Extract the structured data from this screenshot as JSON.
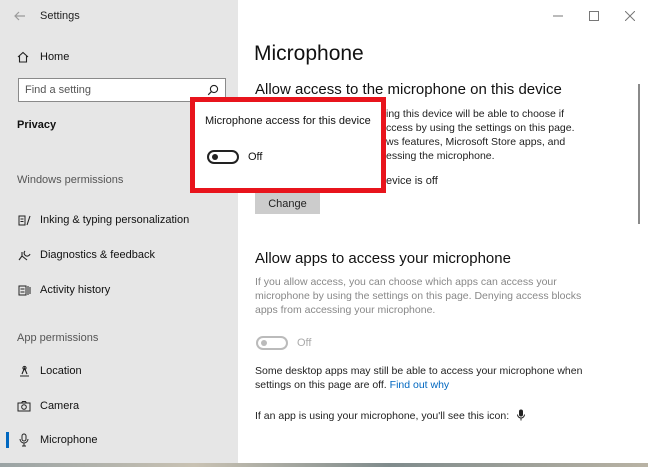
{
  "window": {
    "title": "Settings"
  },
  "sidebar": {
    "home_label": "Home",
    "search_placeholder": "Find a setting",
    "section_title": "Privacy",
    "windows_permissions": {
      "header": "Windows permissions",
      "items": [
        {
          "label": "Inking & typing personalization",
          "icon": "inking-icon"
        },
        {
          "label": "Diagnostics & feedback",
          "icon": "diagnostics-icon"
        },
        {
          "label": "Activity history",
          "icon": "activity-history-icon"
        }
      ]
    },
    "app_permissions": {
      "header": "App permissions",
      "items": [
        {
          "label": "Location",
          "icon": "location-icon"
        },
        {
          "label": "Camera",
          "icon": "camera-icon"
        },
        {
          "label": "Microphone",
          "icon": "microphone-icon"
        }
      ]
    }
  },
  "main": {
    "page_title": "Microphone",
    "device_section": {
      "heading": "Allow access to the microphone on this device",
      "desc_lines": [
        "ing this device will be able to choose if",
        "ccess by using the settings on this page.",
        "ws features, Microsoft Store apps, and",
        "essing the microphone."
      ],
      "status_partial": "evice is off",
      "change_button": "Change"
    },
    "apps_section": {
      "heading": "Allow apps to access your microphone",
      "desc_lines": [
        "If you allow access, you can choose which apps can access your",
        "microphone by using the settings on this page. Denying access blocks",
        "apps from accessing your microphone."
      ],
      "toggle_label": "Off",
      "toggle_state": "off",
      "toggle_enabled": false,
      "note_line1": "Some desktop apps may still be able to access your microphone when",
      "note_line2": "settings on this page are off.",
      "find_out_why": "Find out why",
      "icon_note": "If an app is using your microphone, you'll see this icon:"
    }
  },
  "popup": {
    "title": "Microphone access for this device",
    "toggle_label": "Off",
    "toggle_state": "off",
    "border_color": "#e8141c"
  },
  "colors": {
    "accent": "#0067c0",
    "sidebar_bg": "#e6e6e6"
  }
}
